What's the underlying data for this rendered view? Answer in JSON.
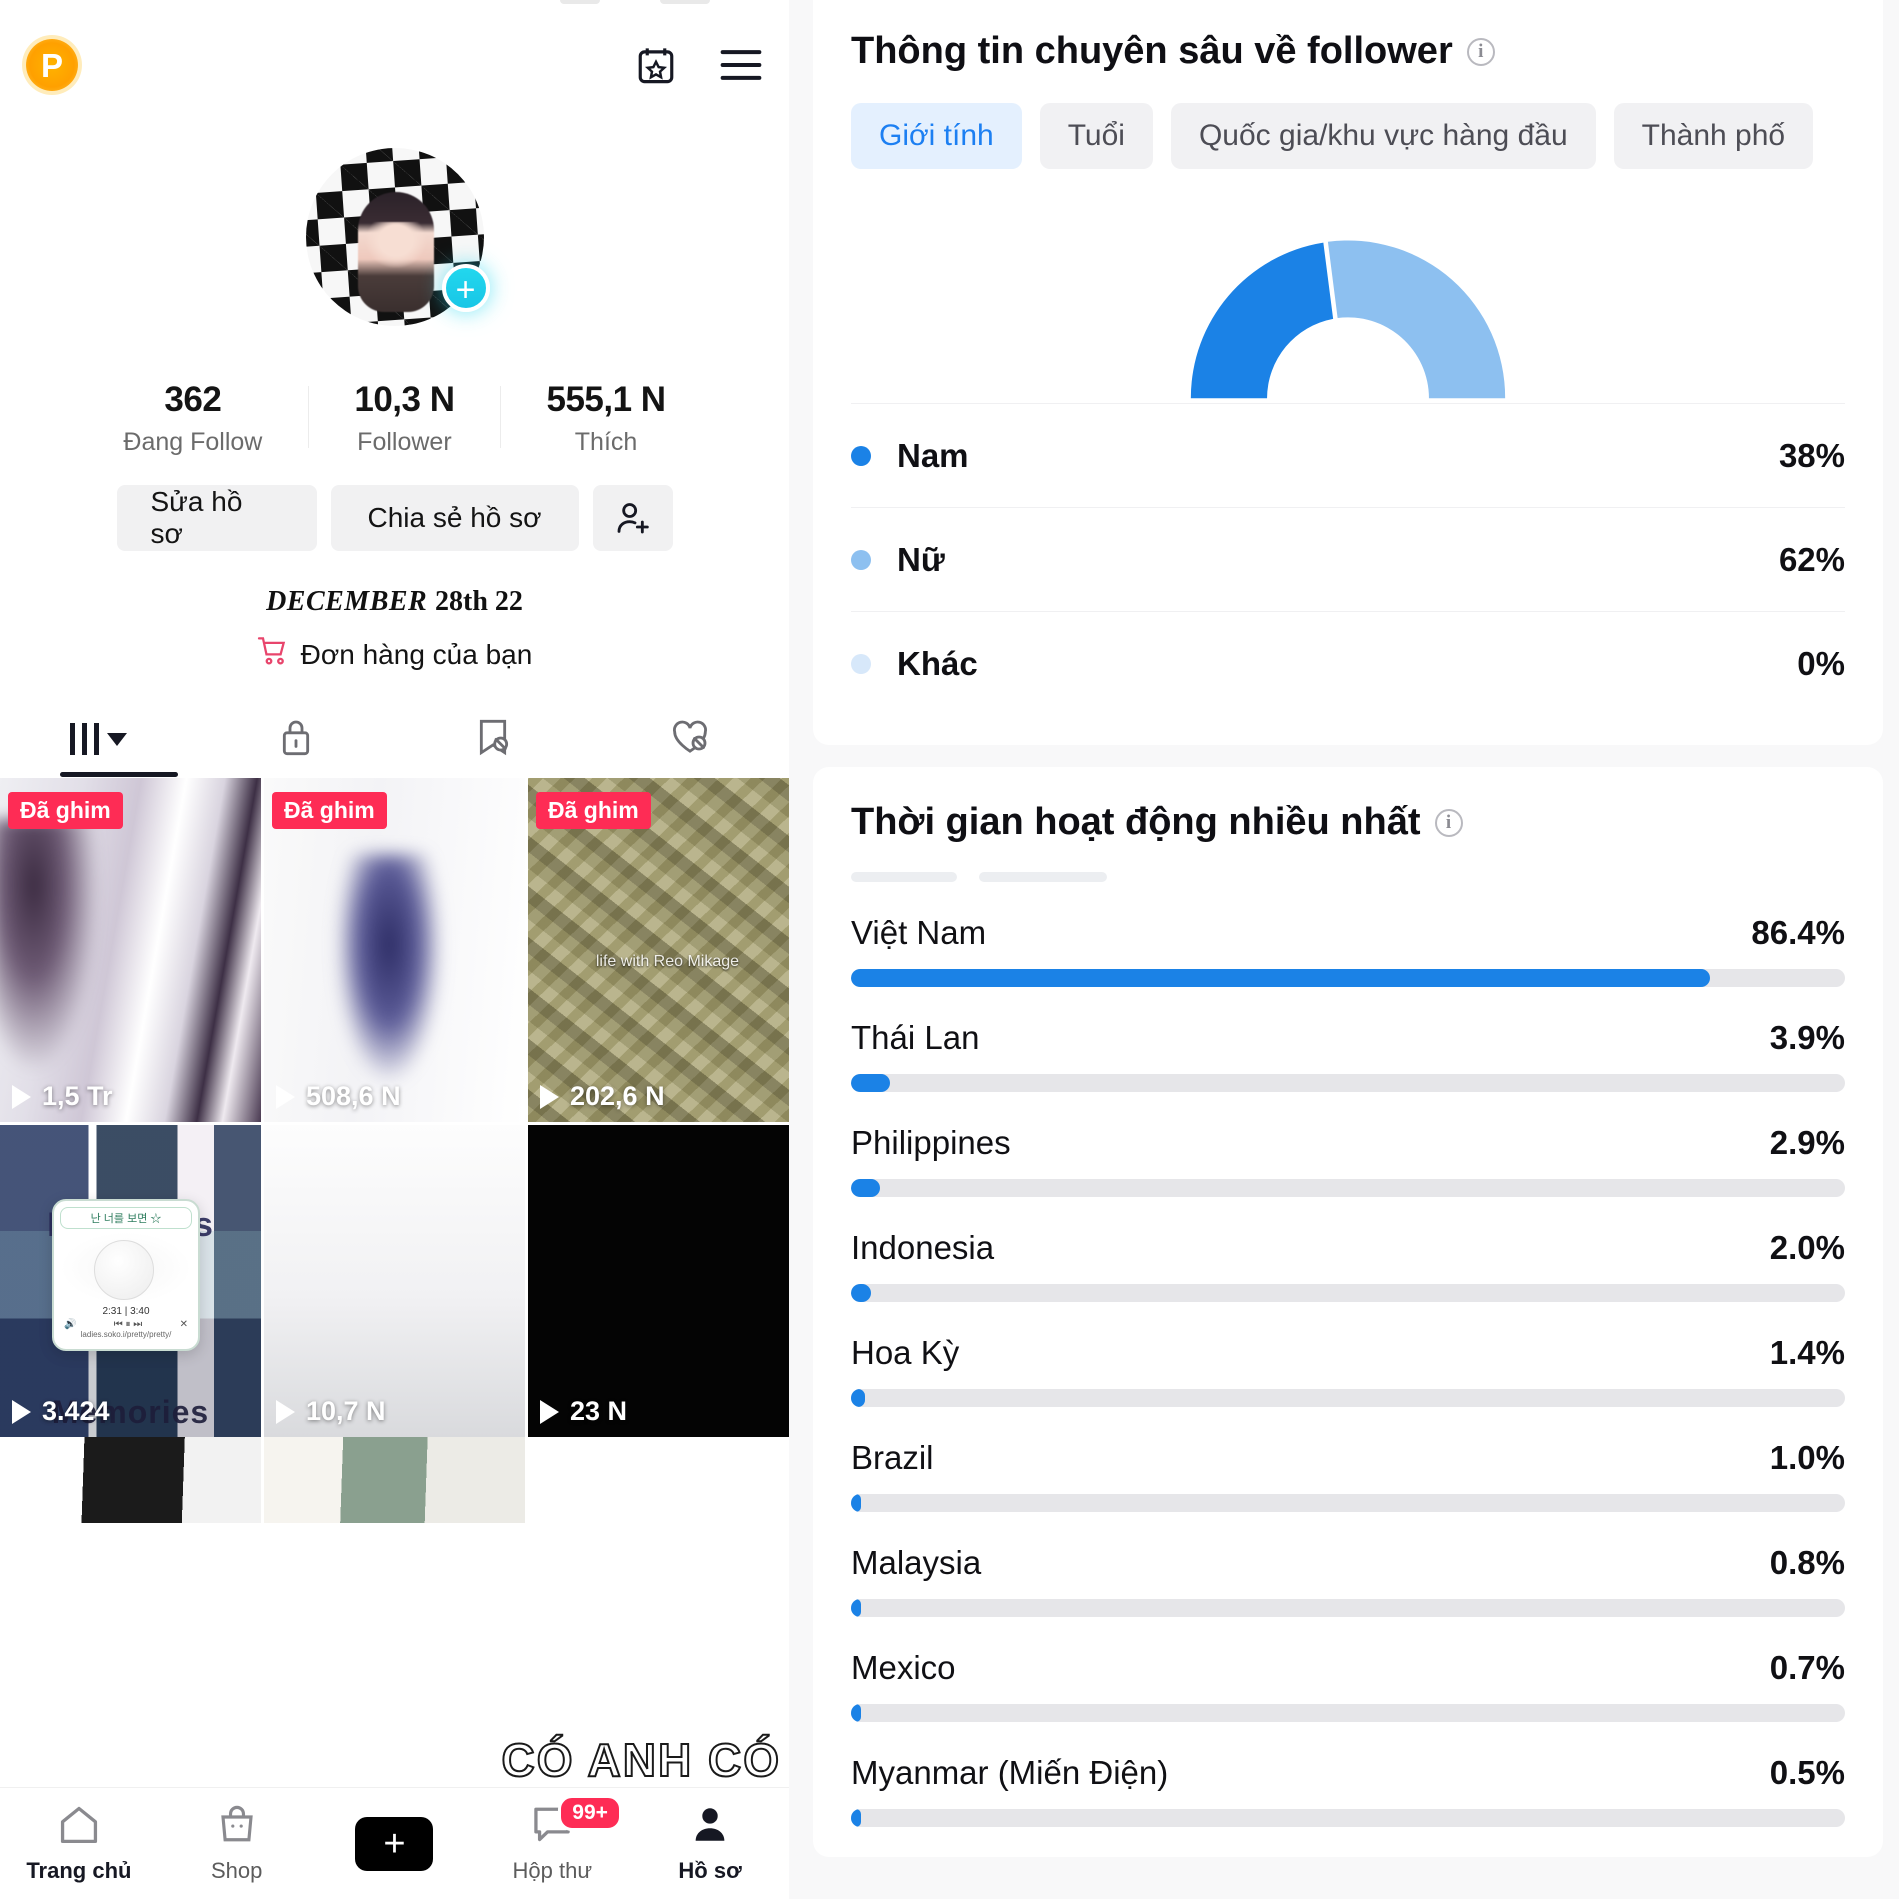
{
  "profile": {
    "rewards_badge": "P",
    "icons": {
      "calendar_star": "calendar-star-icon",
      "menu": "hamburger-menu-icon",
      "add_friend": "add-person-icon",
      "cart": "cart-icon"
    },
    "stats": [
      {
        "value": "362",
        "label": "Đang Follow"
      },
      {
        "value": "10,3 N",
        "label": "Follower"
      },
      {
        "value": "555,1 N",
        "label": "Thích"
      }
    ],
    "buttons": {
      "edit": "Sửa hồ sơ",
      "share": "Chia sẻ hồ sơ"
    },
    "bio_date_month": "DECEMBER",
    "bio_date_day": "28th 22",
    "orders_link": "Đơn hàng của bạn",
    "tabs": [
      {
        "name": "grid-tab",
        "icon": "grid-icon",
        "active": true
      },
      {
        "name": "private-tab",
        "icon": "lock-icon",
        "active": false
      },
      {
        "name": "saved-tab",
        "icon": "bookmark-hidden-icon",
        "active": false
      },
      {
        "name": "liked-tab",
        "icon": "heart-hidden-icon",
        "active": false
      }
    ],
    "videos": [
      {
        "pinned_label": "Đã ghim",
        "views": "1,5 Tr"
      },
      {
        "pinned_label": "Đã ghim",
        "views": "508,6 N"
      },
      {
        "pinned_label": "Đã ghim",
        "views": "202,6 N",
        "watermark": "life with Reo Mikage"
      },
      {
        "pinned_label": "",
        "views": "3.424",
        "overlay_title": "Memories",
        "overlay_title2": "Memories"
      },
      {
        "pinned_label": "",
        "views": "10,7 N"
      },
      {
        "pinned_label": "",
        "views": "23 N"
      }
    ],
    "music_card": {
      "title": "난 너를 보면 ☆",
      "time": "2:31 | 3:40",
      "url": "ladies.soko.i/pretty/pretty/"
    },
    "watermark": "CÓ ANH CÓ",
    "bottom_nav": [
      {
        "label": "Trang chủ",
        "icon": "home-icon",
        "active": true
      },
      {
        "label": "Shop",
        "icon": "shop-bag-icon",
        "active": false
      },
      {
        "label": "",
        "icon": "create-plus-icon",
        "active": false
      },
      {
        "label": "Hộp thư",
        "icon": "inbox-icon",
        "badge": "99+",
        "active": false
      },
      {
        "label": "Hồ sơ",
        "icon": "person-icon",
        "active": true
      }
    ]
  },
  "analytics": {
    "follower_card": {
      "title": "Thông tin chuyên sâu về follower",
      "info_icon": "info-icon",
      "chips": [
        "Giới tính",
        "Tuổi",
        "Quốc gia/khu vực hàng đầu",
        "Thành phố"
      ],
      "active_chip": "Giới tính"
    },
    "activity_card": {
      "title": "Thời gian hoạt động nhiều nhất",
      "info_icon": "info-icon"
    },
    "colors": {
      "primary_blue": "#1b82e6",
      "light_blue": "#8dc0f0",
      "pale_blue": "#d7e8fa",
      "chip_active_text": "#1c7ff2"
    }
  },
  "chart_data": [
    {
      "type": "pie",
      "title": "Giới tính",
      "chart_style": "half-donut gauge",
      "labels": [
        "Nam",
        "Nữ",
        "Khác"
      ],
      "values": [
        38,
        62,
        0
      ],
      "value_labels": [
        "38%",
        "62%",
        "0%"
      ],
      "colors": [
        "#1b82e6",
        "#8dc0f0",
        "#d7e8fa"
      ],
      "legend": "below",
      "unit": "%"
    },
    {
      "type": "bar",
      "title": "Thời gian hoạt động nhiều nhất",
      "orientation": "horizontal",
      "categories": [
        "Việt Nam",
        "Thái Lan",
        "Philippines",
        "Indonesia",
        "Hoa Kỳ",
        "Brazil",
        "Malaysia",
        "Mexico",
        "Myanmar (Miến Điện)"
      ],
      "values": [
        86.4,
        3.9,
        2.9,
        2.0,
        1.4,
        1.0,
        0.8,
        0.7,
        0.5
      ],
      "value_labels": [
        "86.4%",
        "3.9%",
        "2.9%",
        "2.0%",
        "1.4%",
        "1.0%",
        "0.8%",
        "0.7%",
        "0.5%"
      ],
      "xlim": [
        0,
        100
      ],
      "grid": false,
      "bar_color": "#1b82e6",
      "track_color": "#e6e6e9",
      "unit": "%"
    }
  ]
}
